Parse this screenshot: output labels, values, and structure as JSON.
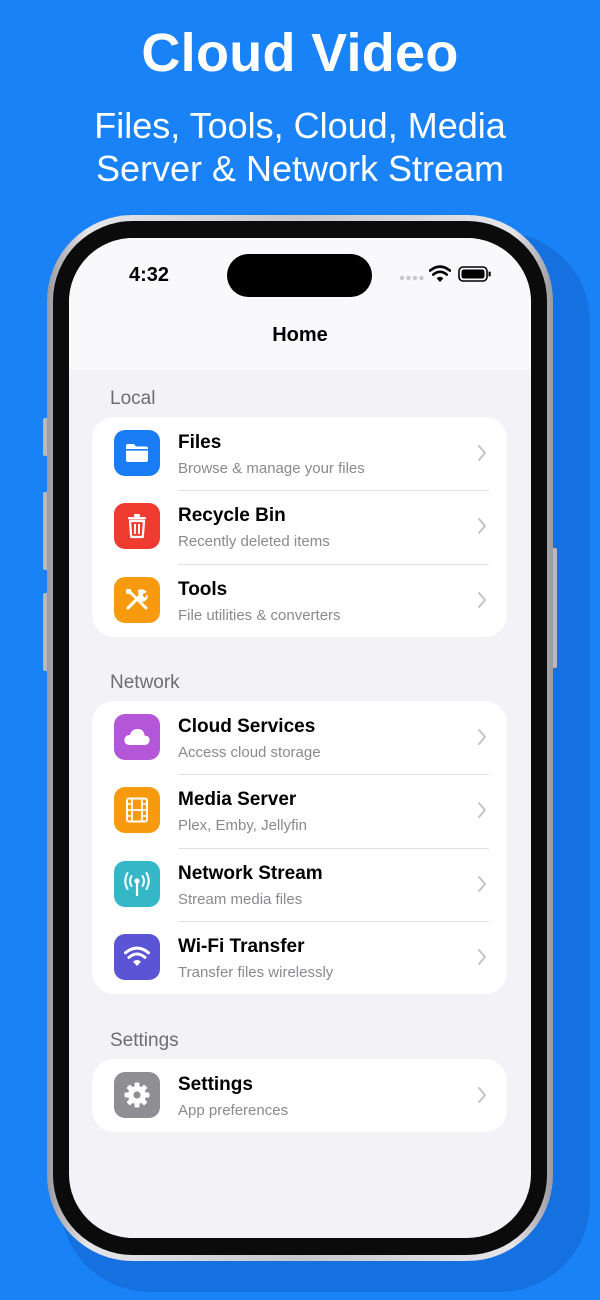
{
  "banner": {
    "title": "Cloud Video",
    "subtitle_line1": "Files, Tools, Cloud, Media",
    "subtitle_line2": "Server & Network Stream"
  },
  "status_bar": {
    "time": "4:32"
  },
  "nav": {
    "title": "Home"
  },
  "colors": {
    "background": "#1a82f7",
    "files": "#1a7cf5",
    "recycle_bin": "#ef3b30",
    "tools": "#f79a0d",
    "cloud_services": "#b357d8",
    "media_server": "#f79a0d",
    "network_stream": "#36b7c8",
    "wifi_transfer": "#5b55d6",
    "settings": "#8e8e93"
  },
  "sections": [
    {
      "header": "Local",
      "items": [
        {
          "title": "Files",
          "subtitle": "Browse & manage your files",
          "icon": "folder-icon"
        },
        {
          "title": "Recycle Bin",
          "subtitle": "Recently deleted items",
          "icon": "trash-icon"
        },
        {
          "title": "Tools",
          "subtitle": "File utilities & converters",
          "icon": "tools-icon"
        }
      ]
    },
    {
      "header": "Network",
      "items": [
        {
          "title": "Cloud Services",
          "subtitle": "Access cloud storage",
          "icon": "cloud-icon"
        },
        {
          "title": "Media Server",
          "subtitle": "Plex, Emby, Jellyfin",
          "icon": "film-icon"
        },
        {
          "title": "Network Stream",
          "subtitle": "Stream media files",
          "icon": "antenna-icon"
        },
        {
          "title": "Wi-Fi Transfer",
          "subtitle": "Transfer files wirelessly",
          "icon": "wifi-icon"
        }
      ]
    },
    {
      "header": "Settings",
      "items": [
        {
          "title": "Settings",
          "subtitle": "App preferences",
          "icon": "gear-icon"
        }
      ]
    }
  ]
}
